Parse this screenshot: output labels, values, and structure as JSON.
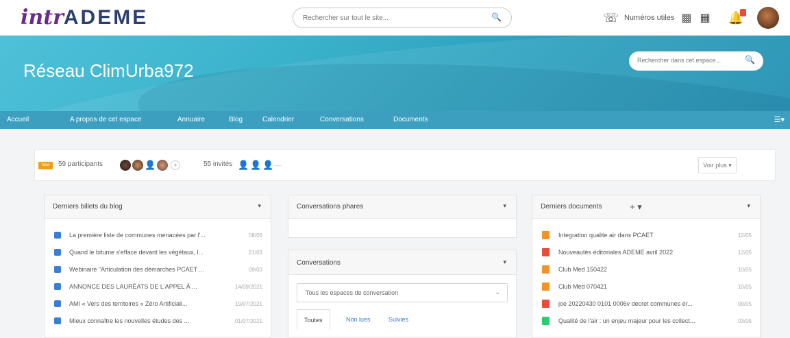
{
  "header": {
    "logo_prefix": "intr",
    "logo_main": "ADEME",
    "search_placeholder": "Rechercher sur tout le site...",
    "phone_label": "Numéros utiles"
  },
  "banner": {
    "title": "Réseau ClimUrba972",
    "search_placeholder": "Rechercher dans cet espace..."
  },
  "nav": {
    "items": [
      "Accueil",
      "A propos de cet espace",
      "Annuaire",
      "Blog",
      "Calendrier",
      "Conversations",
      "Documents"
    ]
  },
  "participants": {
    "badge": "New",
    "count_label": "59 participants",
    "invites_label": "55 invités",
    "more_button": "Voir plus ▾"
  },
  "blog": {
    "title": "Derniers billets du blog",
    "items": [
      {
        "title": "La première liste de communes menacées par l'...",
        "date": "08/05"
      },
      {
        "title": "Quand le bitume s'efface devant les végétaux, l...",
        "date": "21/03"
      },
      {
        "title": "Webinaire \"Articulation des démarches PCAET ...",
        "date": "09/03"
      },
      {
        "title": "ANNONCE DES LAURÉATS DE L'APPEL À ...",
        "date": "14/09/2021"
      },
      {
        "title": "AMI « Vers des territoires « Zéro Artificiali...",
        "date": "19/07/2021"
      },
      {
        "title": "Mieux connaître les nouvelles études des ...",
        "date": "01/07/2021"
      }
    ]
  },
  "conv_pinned": {
    "title": "Conversations phares"
  },
  "conversations": {
    "title": "Conversations",
    "select_value": "Tous les espaces de conversation",
    "tabs": [
      "Toutes",
      "Non lues",
      "Suivies"
    ]
  },
  "documents": {
    "title": "Derniers documents",
    "items": [
      {
        "title": "Integration qualite air dans PCAET",
        "date": "12/05",
        "color": "#f0932b"
      },
      {
        "title": "Nouveautés éditoriales ADEME avril 2022",
        "date": "12/05",
        "color": "#e74c3c"
      },
      {
        "title": "Club Med 150422",
        "date": "10/05",
        "color": "#f0932b"
      },
      {
        "title": "Club Med 070421",
        "date": "10/05",
        "color": "#f0932b"
      },
      {
        "title": "joe 20220430 0101 0006v decret communes ér...",
        "date": "09/05",
        "color": "#e74c3c"
      },
      {
        "title": "Qualité de l'air : un enjeu majeur pour les collect...",
        "date": "03/05",
        "color": "#2ecc71"
      }
    ]
  },
  "colors": {
    "banner": "#3bb2cc",
    "nav": "#3d9fbf",
    "logo_intra": "#6b2a8a",
    "logo_ademe": "#2c3e6e",
    "badge": "#f39c12",
    "blog_icon": "#3a7fd5"
  }
}
